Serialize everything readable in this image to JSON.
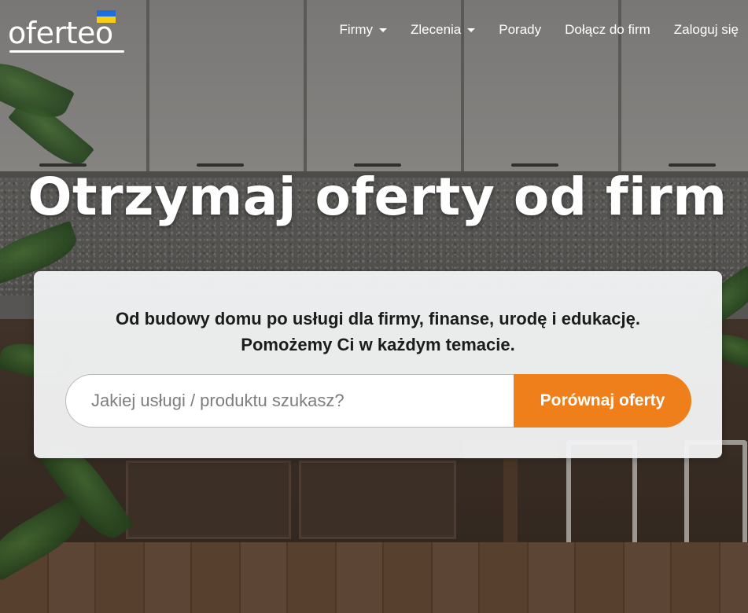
{
  "brand": {
    "logo_text": "oferteo",
    "flag_icon": "ukraine-flag-icon",
    "accent": "#ef7f1a"
  },
  "nav": {
    "items": [
      {
        "label": "Firmy",
        "has_dropdown": true
      },
      {
        "label": "Zlecenia",
        "has_dropdown": true
      },
      {
        "label": "Porady",
        "has_dropdown": false
      },
      {
        "label": "Dołącz do firm",
        "has_dropdown": false
      },
      {
        "label": "Zaloguj się",
        "has_dropdown": false
      }
    ]
  },
  "hero": {
    "title": "Otrzymaj oferty od firm",
    "subtitle_line1": "Od budowy domu po usługi dla firmy, finanse, urodę i edukację.",
    "subtitle_line2": "Pomożemy Ci w każdym temacie."
  },
  "search": {
    "placeholder": "Jakiej usługi / produktu szukasz?",
    "value": "",
    "button_label": "Porównaj oferty"
  }
}
